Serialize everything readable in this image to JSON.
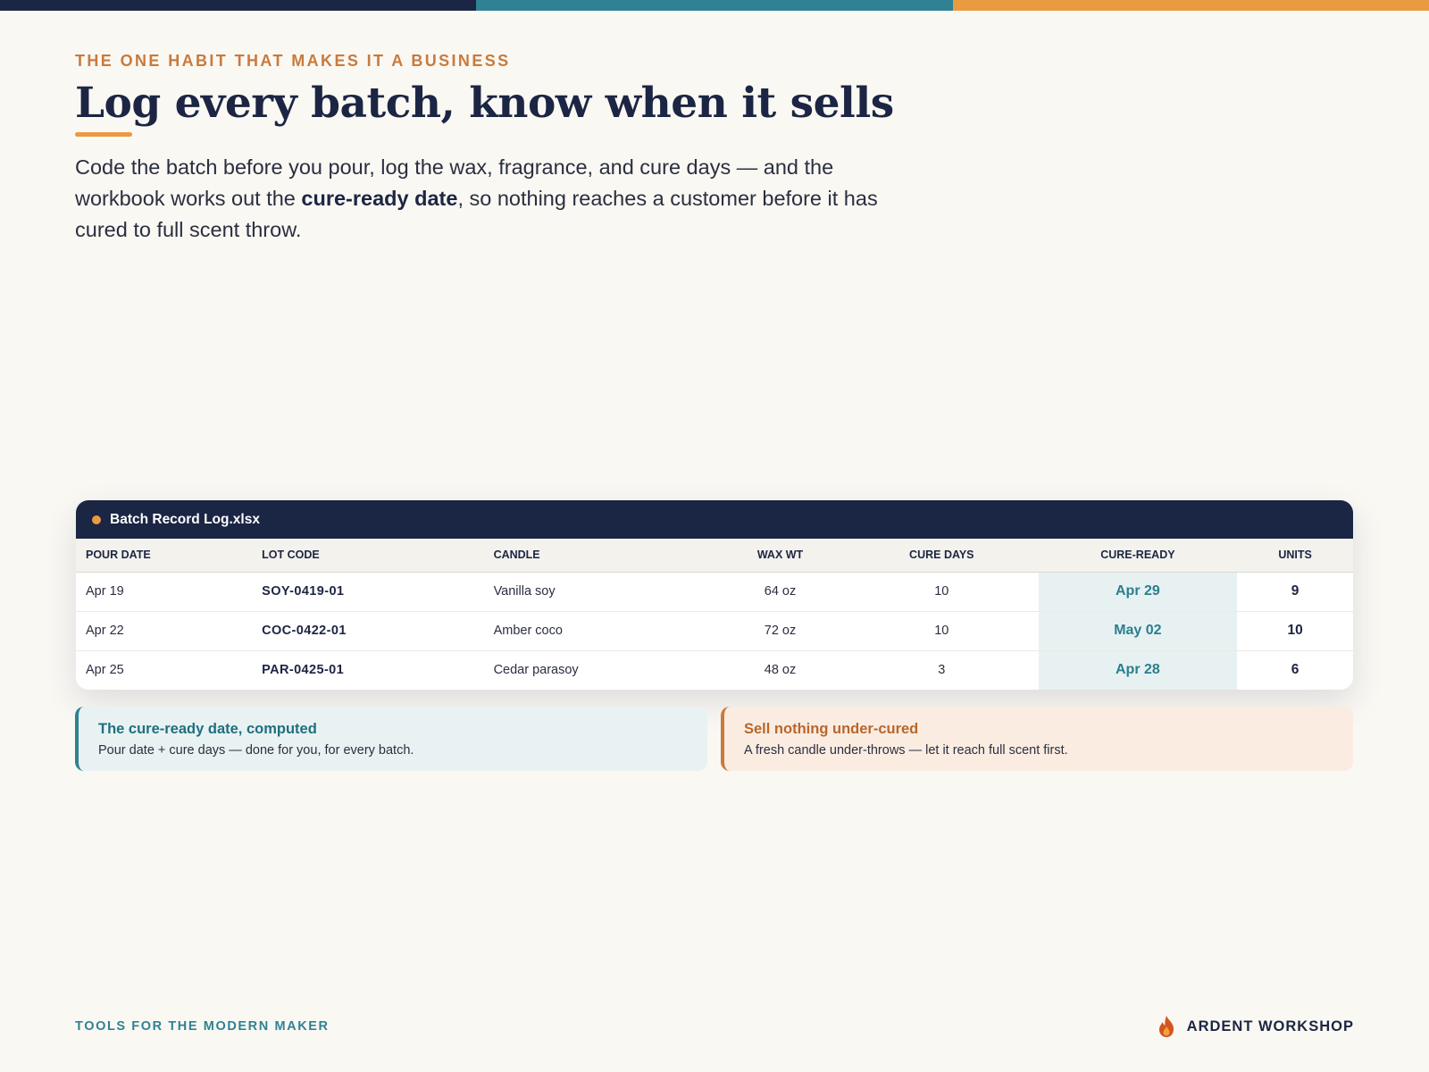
{
  "colors": {
    "navy": "#1b2544",
    "teal": "#2e8294",
    "orange": "#ea9a40",
    "rust": "#c97a3c"
  },
  "header": {
    "eyebrow": "THE ONE HABIT THAT MAKES IT A BUSINESS",
    "title": "Log every batch, know when it sells",
    "intro_part1": "Code the batch before you pour, log the wax, fragrance, and cure days — and the workbook works out the ",
    "intro_bold": "cure-ready date",
    "intro_part2": ", so nothing reaches a customer before it has cured to full scent throw."
  },
  "sheet": {
    "filename": "Batch Record Log.xlsx",
    "columns": [
      "POUR DATE",
      "LOT CODE",
      "CANDLE",
      "WAX WT",
      "CURE DAYS",
      "CURE-READY",
      "UNITS"
    ],
    "rows": [
      [
        "Apr 19",
        "SOY-0419-01",
        "Vanilla soy",
        "64 oz",
        "10",
        "Apr 29",
        "9"
      ],
      [
        "Apr 22",
        "COC-0422-01",
        "Amber coco",
        "72 oz",
        "10",
        "May 02",
        "10"
      ],
      [
        "Apr 25",
        "PAR-0425-01",
        "Cedar parasoy",
        "48 oz",
        "3",
        "Apr 28",
        "6"
      ]
    ]
  },
  "notes": {
    "computed": {
      "title": "The cure-ready date, computed",
      "body": "Pour date + cure days — done for you, for every batch."
    },
    "undercured": {
      "title": "Sell nothing under-cured",
      "body": "A fresh candle under-throws — let it reach full scent first."
    }
  },
  "footer": {
    "tagline": "TOOLS FOR THE MODERN MAKER",
    "brand": "ARDENT WORKSHOP",
    "brand_icon": "flame-icon"
  }
}
